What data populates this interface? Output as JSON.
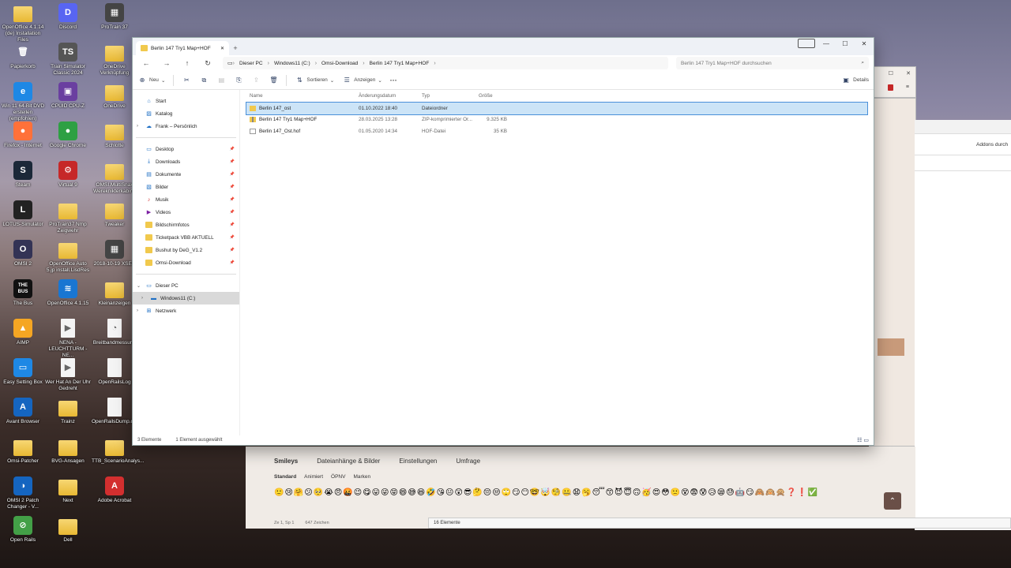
{
  "desktop": {
    "icons": [
      {
        "label": "OpenOffice 4.1.14 (de) Installation Files",
        "glyph": "",
        "kind": "folder",
        "x": 0,
        "y": 0
      },
      {
        "label": "Discord",
        "glyph": "D",
        "kind": "app",
        "color": "#5865f2"
      },
      {
        "label": "ProTrain 37",
        "glyph": "▦",
        "kind": "app",
        "color": "#444"
      },
      {
        "label": "Papierkorb",
        "glyph": "🗑",
        "kind": "app",
        "color": "transparent"
      },
      {
        "label": "Train Simulator Classic 2024",
        "glyph": "TS",
        "kind": "app",
        "color": "#555"
      },
      {
        "label": "OneDrive Verknüpfung",
        "glyph": "",
        "kind": "folder"
      },
      {
        "label": "Win 11 64-Bit DVD erstellen (empfohlen)",
        "glyph": "e",
        "kind": "app",
        "color": "#1e88e5"
      },
      {
        "label": "CPUID CPU-Z",
        "glyph": "▣",
        "kind": "app",
        "color": "#6a3fa0"
      },
      {
        "label": "OneDrive",
        "glyph": "",
        "kind": "folder"
      },
      {
        "label": "Firefox - Internet",
        "glyph": "●",
        "kind": "app",
        "color": "#ff7139"
      },
      {
        "label": "Google Chrome",
        "glyph": "●",
        "kind": "app",
        "color": "#2ea043"
      },
      {
        "label": "Schlotte",
        "glyph": "",
        "kind": "folder"
      },
      {
        "label": "Steam",
        "glyph": "S",
        "kind": "app",
        "color": "#1b2838"
      },
      {
        "label": "Virtual 9",
        "glyph": "⚙",
        "kind": "app",
        "color": "#c62828"
      },
      {
        "label": "OMSI.MultiSnax Wereknikterkabine",
        "glyph": "",
        "kind": "folder"
      },
      {
        "label": "LOTUS-Simulator",
        "glyph": "L",
        "kind": "app",
        "color": "#222"
      },
      {
        "label": "ProTrain37 Nmp Zeigwehr",
        "glyph": "",
        "kind": "folder"
      },
      {
        "label": "Tweaker",
        "glyph": "",
        "kind": "folder"
      },
      {
        "label": "OMSI 2",
        "glyph": "O",
        "kind": "app",
        "color": "#335"
      },
      {
        "label": "OpenOffice Auto 5.jp install.LisdRes",
        "glyph": "",
        "kind": "folder"
      },
      {
        "label": "2018-10-19 XSEP",
        "glyph": "▦",
        "kind": "app",
        "color": "#444"
      },
      {
        "label": "The Bus",
        "glyph": "THE BUS",
        "kind": "app",
        "color": "#111"
      },
      {
        "label": "OpenOffice 4.1.15",
        "glyph": "≋",
        "kind": "app",
        "color": "#1976d2"
      },
      {
        "label": "Kleinanzeigen",
        "glyph": "",
        "kind": "folder"
      },
      {
        "label": "AIMP",
        "glyph": "▲",
        "kind": "app",
        "color": "#f5a623"
      },
      {
        "label": "NENA - LEUCHTTURM - NE...",
        "glyph": "▶",
        "kind": "doc"
      },
      {
        "label": "Breitbandmessung",
        "glyph": "◔",
        "kind": "doc"
      },
      {
        "label": "Easy Setting Box",
        "glyph": "▭",
        "kind": "app",
        "color": "#1e88e5"
      },
      {
        "label": "Wer Hat An Der Uhr Gedreht",
        "glyph": "▶",
        "kind": "doc"
      },
      {
        "label": "OpenRailsLog",
        "glyph": "",
        "kind": "doc"
      },
      {
        "label": "Avant Browser",
        "glyph": "A",
        "kind": "app",
        "color": "#1565c0"
      },
      {
        "label": "Trainz",
        "glyph": "",
        "kind": "folder"
      },
      {
        "label": "OpenRailsDump.csv",
        "glyph": "",
        "kind": "doc"
      },
      {
        "label": "Omsi-Patcher",
        "glyph": "",
        "kind": "folder"
      },
      {
        "label": "BVG-Ansagen",
        "glyph": "",
        "kind": "folder"
      },
      {
        "label": "TTB_ScenarioAnalys...",
        "glyph": "",
        "kind": "folder"
      },
      {
        "label": "OMSI 2 Patch Changer - V...",
        "glyph": "◑",
        "kind": "app",
        "color": "#1565c0"
      },
      {
        "label": "Next",
        "glyph": "",
        "kind": "folder"
      },
      {
        "label": "Adobe Acrobat",
        "glyph": "A",
        "kind": "app",
        "color": "#d32f2f"
      },
      {
        "label": "Open Rails",
        "glyph": "⊘",
        "kind": "app",
        "color": "#43a047"
      },
      {
        "label": "Dell",
        "glyph": "",
        "kind": "folder"
      }
    ]
  },
  "explorer": {
    "tab_title": "Berlin 147 Try1 Map+HOF",
    "new_tab": "+",
    "window_controls": {
      "minimize": "—",
      "maximize": "☐",
      "close": "✕"
    },
    "nav": {
      "back": "←",
      "forward": "→",
      "up": "↑",
      "refresh": "↻",
      "pc_icon": "🖥"
    },
    "breadcrumbs": [
      "Dieser PC",
      "Windows11 (C:)",
      "Omsi-Download",
      "Berlin 147 Try1 Map+HOF"
    ],
    "search_placeholder": "Berlin 147 Try1 Map+HOF durchsuchen",
    "toolbar": {
      "new": "Neu",
      "sort": "Sortieren",
      "view": "Anzeigen",
      "more": "···",
      "details": "Details"
    },
    "sidebar": {
      "quick": [
        {
          "label": "Start",
          "icon": "home-icon"
        },
        {
          "label": "Katalog",
          "icon": "gallery-icon"
        },
        {
          "label": "Frank – Persönlich",
          "icon": "onedrive-icon"
        }
      ],
      "pinned": [
        {
          "label": "Desktop",
          "icon": "desktop-icon"
        },
        {
          "label": "Downloads",
          "icon": "download-icon"
        },
        {
          "label": "Dokumente",
          "icon": "documents-icon"
        },
        {
          "label": "Bilder",
          "icon": "pictures-icon"
        },
        {
          "label": "Musik",
          "icon": "music-icon"
        },
        {
          "label": "Videos",
          "icon": "videos-icon"
        },
        {
          "label": "Bildschirmfotos",
          "icon": "folder-icon"
        },
        {
          "label": "Ticketpack VBB AKTUELL",
          "icon": "folder-icon"
        },
        {
          "label": "Bushut by DeG_V1.2",
          "icon": "folder-icon"
        },
        {
          "label": "Omsi-Download",
          "icon": "folder-icon"
        }
      ],
      "devices": [
        {
          "label": "Dieser PC",
          "icon": "pc-icon"
        },
        {
          "label": "Windows11 (C:)",
          "icon": "drive-icon"
        },
        {
          "label": "Netzwerk",
          "icon": "network-icon"
        }
      ]
    },
    "columns": {
      "name": "Name",
      "date": "Änderungsdatum",
      "type": "Typ",
      "size": "Größe"
    },
    "files": [
      {
        "name": "Berlin 147_ost",
        "date": "01.10.2022 18:40",
        "type": "Dateiordner",
        "size": "",
        "kind": "folder",
        "selected": true
      },
      {
        "name": "Berlin 147 Try1 Map+HOF",
        "date": "28.03.2025 13:28",
        "type": "ZIP-komprimierter Or...",
        "size": "9.325 KB",
        "kind": "zip",
        "selected": false
      },
      {
        "name": "Berlin 147_Ost.hof",
        "date": "01.05.2020 14:34",
        "type": "HOF-Datei",
        "size": "35 KB",
        "kind": "file",
        "selected": false
      }
    ],
    "status": {
      "count": "3 Elemente",
      "selection": "1 Element ausgewählt"
    }
  },
  "browser_bg": {
    "addons_text": "Addons durch"
  },
  "forum": {
    "tabs": [
      "Smileys",
      "Dateianhänge & Bilder",
      "Einstellungen",
      "Umfrage"
    ],
    "subtabs": [
      "Standard",
      "Animiert",
      "ÖPNV",
      "Marken"
    ],
    "emojis": "🙂😢🤗😕🥺😭😠🤬😉😋😛😜😝😄😅😆🤣😘😐😲😎🤔😔😒🙄😏😶🤓🤯🧐🤐😧🥱😴😙😈😇🙃🥳😍😳🙁😵😨😰😥😪😓🤖😏🙈🙉🙊❓❗✅",
    "status_line": "Ze 1, Sp 1",
    "chars": "647 Zeichen",
    "scroll_top": "⌃"
  },
  "chat": {
    "count": "16 Elemente"
  }
}
